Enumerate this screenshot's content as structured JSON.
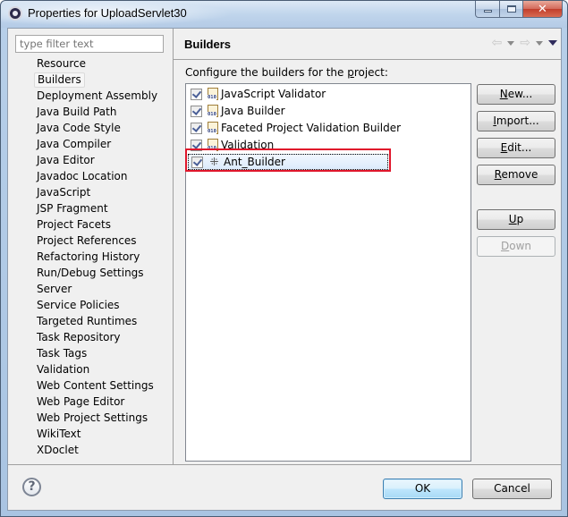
{
  "window": {
    "title": "Properties for UploadServlet30",
    "icon": "eclipse-gear-icon",
    "controls": {
      "minimize": "minimize-icon",
      "maximize": "maximize-icon",
      "close": "close-icon",
      "close_glyph": "✕"
    }
  },
  "filter": {
    "placeholder": "type filter text",
    "value": ""
  },
  "nav": {
    "selected": "Builders",
    "items": [
      {
        "label": "Resource"
      },
      {
        "label": "Builders"
      },
      {
        "label": "Deployment Assembly"
      },
      {
        "label": "Java Build Path"
      },
      {
        "label": "Java Code Style"
      },
      {
        "label": "Java Compiler"
      },
      {
        "label": "Java Editor"
      },
      {
        "label": "Javadoc Location"
      },
      {
        "label": "JavaScript"
      },
      {
        "label": "JSP Fragment"
      },
      {
        "label": "Project Facets"
      },
      {
        "label": "Project References"
      },
      {
        "label": "Refactoring History"
      },
      {
        "label": "Run/Debug Settings"
      },
      {
        "label": "Server"
      },
      {
        "label": "Service Policies"
      },
      {
        "label": "Targeted Runtimes"
      },
      {
        "label": "Task Repository"
      },
      {
        "label": "Task Tags"
      },
      {
        "label": "Validation"
      },
      {
        "label": "Web Content Settings"
      },
      {
        "label": "Web Page Editor"
      },
      {
        "label": "Web Project Settings"
      },
      {
        "label": "WikiText"
      },
      {
        "label": "XDoclet"
      }
    ]
  },
  "page": {
    "title": "Builders",
    "nav_icons": {
      "back": "⇦",
      "forward": "⇨"
    },
    "configure_label": "Configure the builders for the project:",
    "builders": [
      {
        "label": "JavaScript Validator",
        "checked": true,
        "icon": "binary-builder-icon"
      },
      {
        "label": "Java Builder",
        "checked": true,
        "icon": "binary-builder-icon"
      },
      {
        "label": "Faceted Project Validation Builder",
        "checked": true,
        "icon": "binary-builder-icon"
      },
      {
        "label": "Validation",
        "checked": true,
        "icon": "binary-builder-icon"
      },
      {
        "label": "Ant_Builder",
        "checked": true,
        "icon": "ant-icon",
        "selected": true,
        "highlighted": true
      }
    ],
    "ant_glyph": "⁜",
    "buttons": {
      "new": {
        "mnemonic": "N",
        "rest": "ew...",
        "enabled": true
      },
      "import": {
        "mnemonic": "I",
        "rest": "mport...",
        "enabled": true
      },
      "edit": {
        "mnemonic": "E",
        "rest": "dit...",
        "enabled": true
      },
      "remove": {
        "mnemonic": "R",
        "rest": "emove",
        "enabled": true
      },
      "up": {
        "mnemonic": "U",
        "rest": "p",
        "enabled": true
      },
      "down": {
        "mnemonic": "D",
        "rest": "own",
        "enabled": false
      }
    }
  },
  "footer": {
    "help_glyph": "?",
    "ok_label": "OK",
    "cancel_label": "Cancel"
  },
  "colors": {
    "highlight_border": "#e0162b",
    "selection_bg": "#dcebfc",
    "default_button_border": "#3c7fb1"
  }
}
